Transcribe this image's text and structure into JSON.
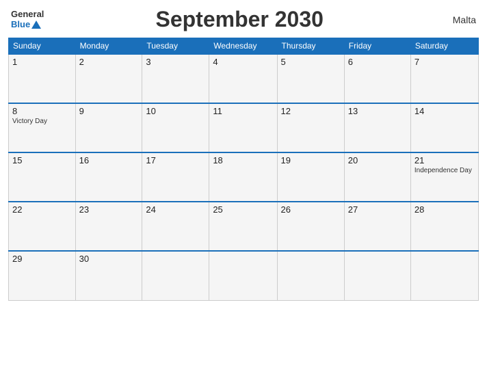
{
  "header": {
    "logo_general": "General",
    "logo_blue": "Blue",
    "title": "September 2030",
    "country": "Malta"
  },
  "weekdays": [
    "Sunday",
    "Monday",
    "Tuesday",
    "Wednesday",
    "Thursday",
    "Friday",
    "Saturday"
  ],
  "weeks": [
    [
      {
        "day": "1",
        "holiday": ""
      },
      {
        "day": "2",
        "holiday": ""
      },
      {
        "day": "3",
        "holiday": ""
      },
      {
        "day": "4",
        "holiday": ""
      },
      {
        "day": "5",
        "holiday": ""
      },
      {
        "day": "6",
        "holiday": ""
      },
      {
        "day": "7",
        "holiday": ""
      }
    ],
    [
      {
        "day": "8",
        "holiday": "Victory Day"
      },
      {
        "day": "9",
        "holiday": ""
      },
      {
        "day": "10",
        "holiday": ""
      },
      {
        "day": "11",
        "holiday": ""
      },
      {
        "day": "12",
        "holiday": ""
      },
      {
        "day": "13",
        "holiday": ""
      },
      {
        "day": "14",
        "holiday": ""
      }
    ],
    [
      {
        "day": "15",
        "holiday": ""
      },
      {
        "day": "16",
        "holiday": ""
      },
      {
        "day": "17",
        "holiday": ""
      },
      {
        "day": "18",
        "holiday": ""
      },
      {
        "day": "19",
        "holiday": ""
      },
      {
        "day": "20",
        "holiday": ""
      },
      {
        "day": "21",
        "holiday": "Independence Day"
      }
    ],
    [
      {
        "day": "22",
        "holiday": ""
      },
      {
        "day": "23",
        "holiday": ""
      },
      {
        "day": "24",
        "holiday": ""
      },
      {
        "day": "25",
        "holiday": ""
      },
      {
        "day": "26",
        "holiday": ""
      },
      {
        "day": "27",
        "holiday": ""
      },
      {
        "day": "28",
        "holiday": ""
      }
    ],
    [
      {
        "day": "29",
        "holiday": ""
      },
      {
        "day": "30",
        "holiday": ""
      },
      {
        "day": "",
        "holiday": ""
      },
      {
        "day": "",
        "holiday": ""
      },
      {
        "day": "",
        "holiday": ""
      },
      {
        "day": "",
        "holiday": ""
      },
      {
        "day": "",
        "holiday": ""
      }
    ]
  ]
}
